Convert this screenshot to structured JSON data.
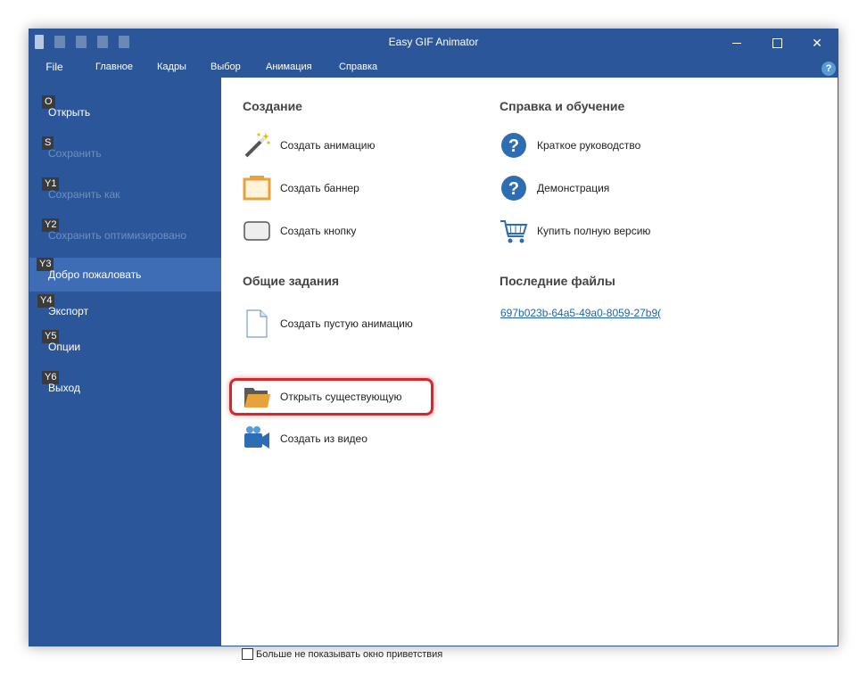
{
  "window": {
    "title": "Easy GIF Animator"
  },
  "tabs": {
    "file": "File",
    "main": "Главное",
    "frames": "Кадры",
    "select": "Выбор",
    "animation": "Анимация",
    "help": "Справка"
  },
  "help_badge": "?",
  "sidebar": {
    "items": [
      {
        "key": "O",
        "label": "Открыть",
        "state": "normal"
      },
      {
        "key": "S",
        "label": "Сохранить",
        "state": "disabled"
      },
      {
        "key": "Y1",
        "label": "Сохранить как",
        "state": "disabled"
      },
      {
        "key": "Y2",
        "label": "Сохранить оптимизировано",
        "state": "disabled"
      },
      {
        "key": "Y3",
        "label": "Добро пожаловать",
        "state": "active"
      },
      {
        "key": "Y4",
        "label": "Экспорт",
        "state": "normal"
      },
      {
        "key": "Y5",
        "label": "Опции",
        "state": "normal"
      },
      {
        "key": "Y6",
        "label": "Выход",
        "state": "normal"
      }
    ]
  },
  "create": {
    "title": "Создание",
    "items": [
      {
        "label": "Создать анимацию",
        "icon": "magic-wand-icon"
      },
      {
        "label": "Создать баннер",
        "icon": "banner-icon"
      },
      {
        "label": "Создать кнопку",
        "icon": "button-icon"
      }
    ]
  },
  "tasks": {
    "title": "Общие задания",
    "items": [
      {
        "label": "Создать пустую анимацию",
        "icon": "blank-document-icon"
      },
      {
        "label": "Открыть существующую",
        "icon": "folder-icon"
      },
      {
        "label": "Создать из видео",
        "icon": "video-camera-icon"
      }
    ]
  },
  "help": {
    "title": "Справка и обучение",
    "items": [
      {
        "label": "Краткое руководство",
        "icon": "help-circle-icon"
      },
      {
        "label": "Демонстрация",
        "icon": "help-circle-icon"
      },
      {
        "label": "Купить полную версию",
        "icon": "shopping-cart-icon"
      }
    ]
  },
  "recent": {
    "title": "Последние файлы",
    "files": [
      "697b023b-64a5-49a0-8059-27b9("
    ]
  },
  "footer": {
    "checkbox_label": "Больше не показывать окно приветствия",
    "checked": false
  },
  "colors": {
    "brand": "#2b579a",
    "highlight": "#d9262b"
  }
}
